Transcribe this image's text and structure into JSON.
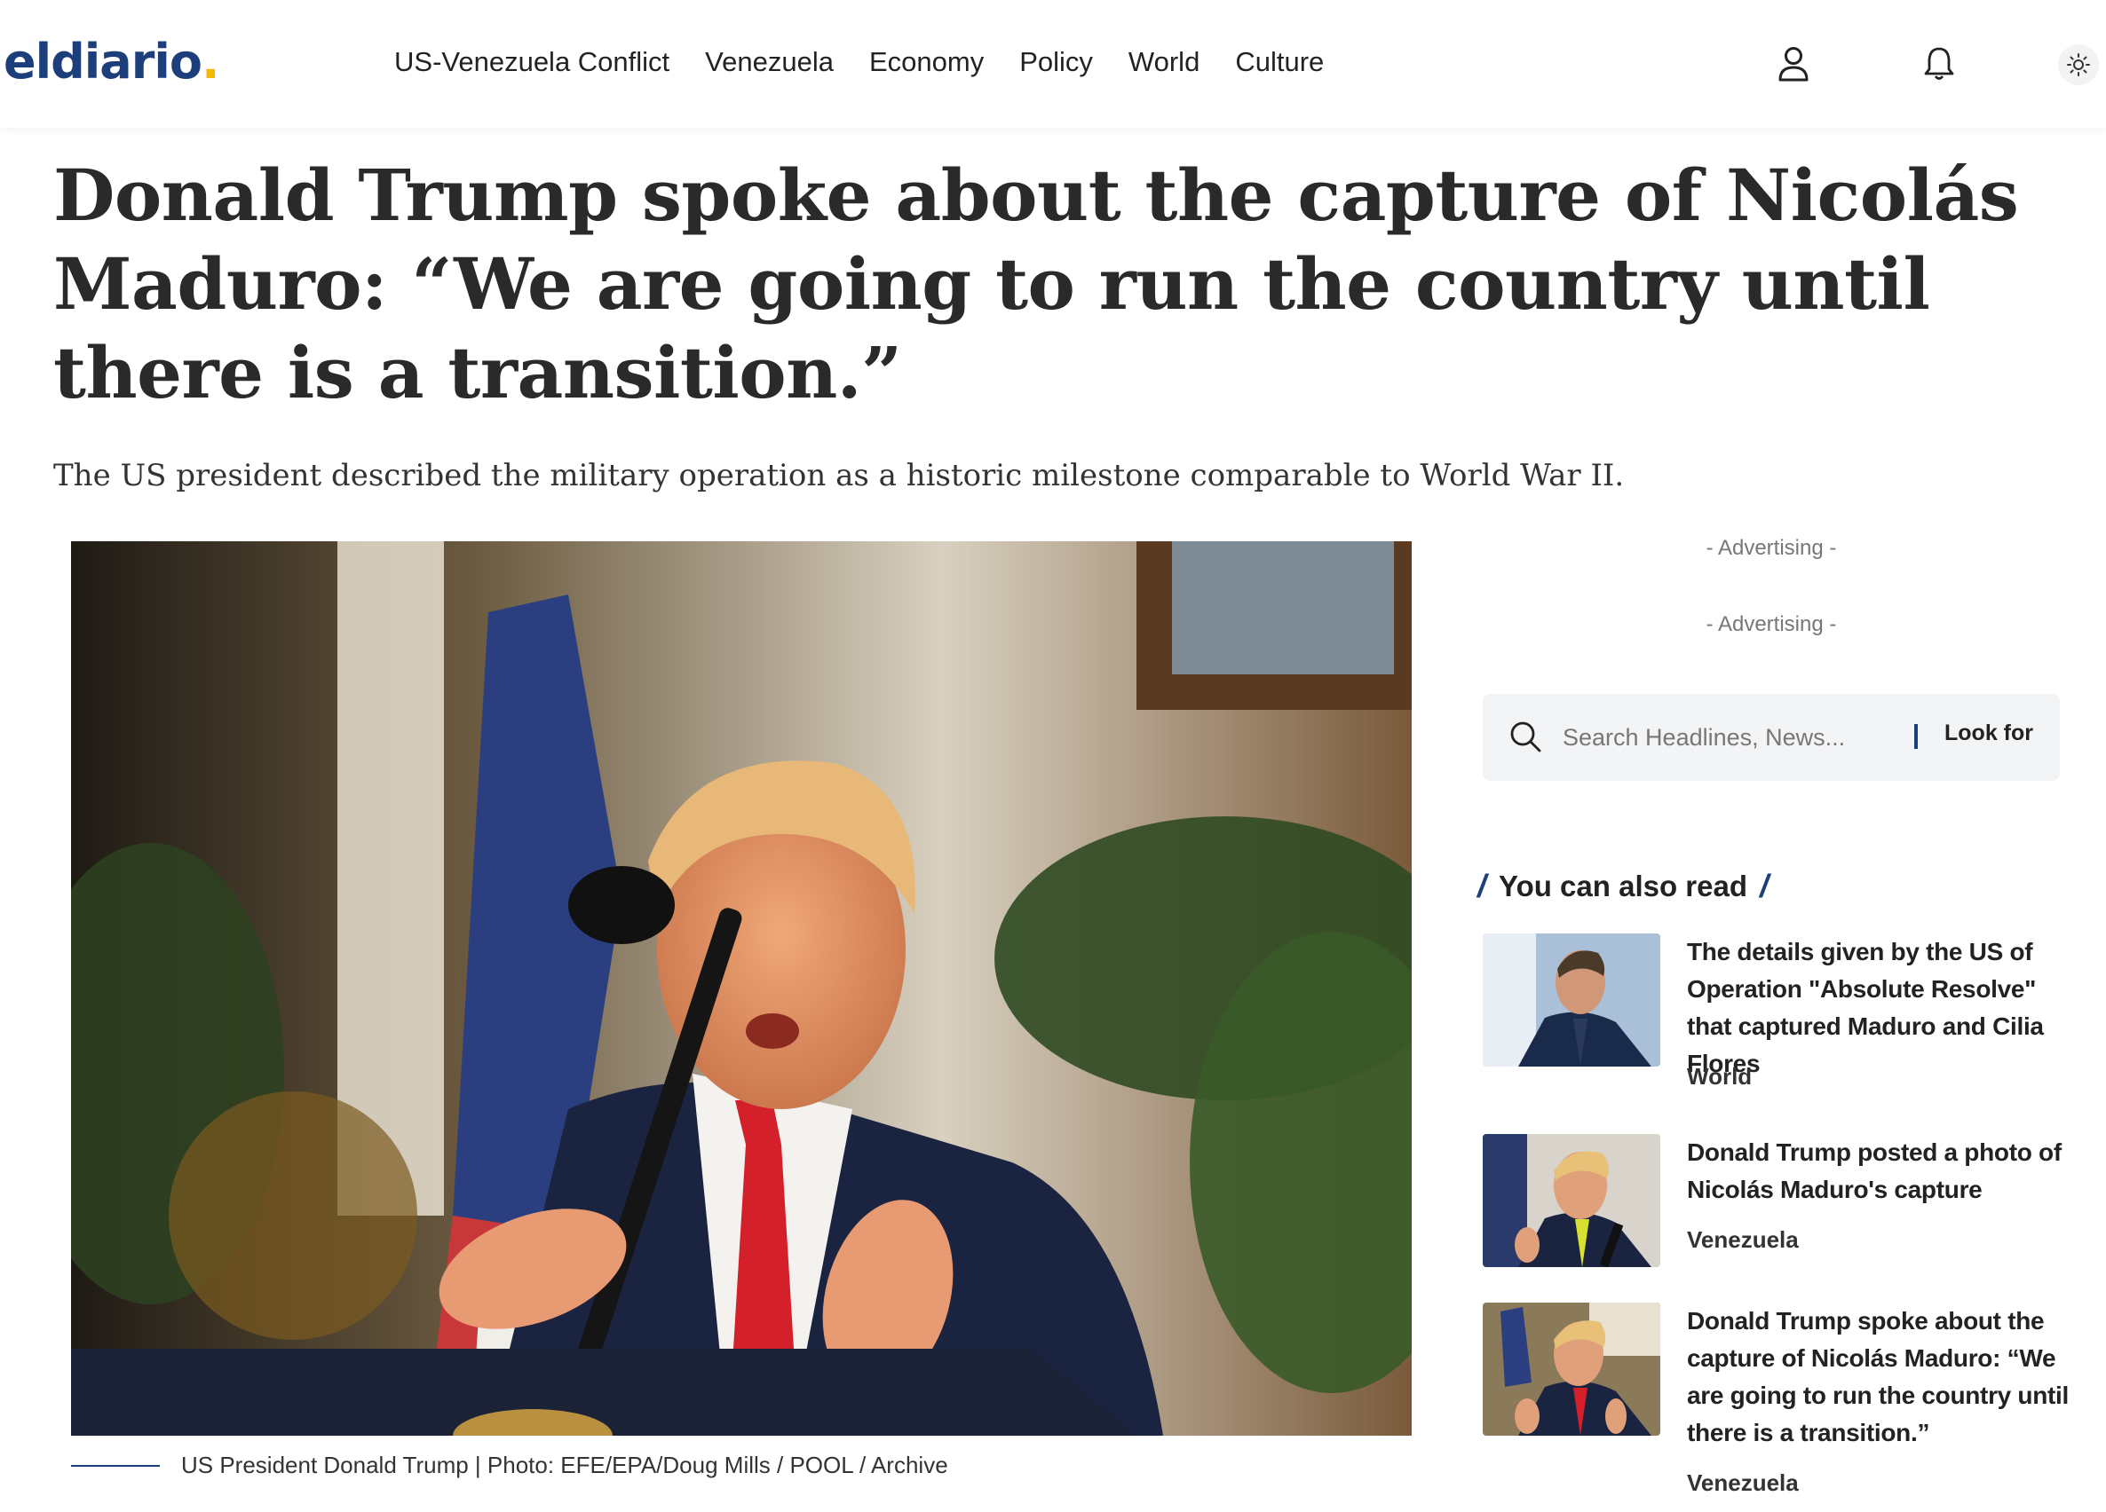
{
  "header": {
    "logo_text": "eldiario",
    "logo_dot": ".",
    "nav": [
      "US-Venezuela Conflict",
      "Venezuela",
      "Economy",
      "Policy",
      "World",
      "Culture"
    ],
    "icons": [
      "user-icon",
      "bell-icon",
      "sun-icon"
    ]
  },
  "article": {
    "headline": "Donald Trump spoke about the capture of Nicolás Maduro: “We are going to run the country until there is a transition.”",
    "subtitle": "The US president described the military operation as a historic milestone comparable to World War II.",
    "caption": "US President Donald Trump | Photo: EFE/EPA/Doug Mills / POOL / Archive"
  },
  "sidebar": {
    "ad_label_1": "- Advertising -",
    "ad_label_2": "- Advertising -",
    "search_placeholder": "Search Headlines, News...",
    "search_button": "Look for",
    "section_title": "You can also read",
    "related": [
      {
        "title": "The details given by the US of Operation \"Absolute Resolve\" that captured Maduro and Cilia Flores",
        "category": "World"
      },
      {
        "title": "Donald Trump posted a photo of Nicolás Maduro's capture",
        "category": "Venezuela"
      },
      {
        "title": "Donald Trump spoke about the capture of Nicolás Maduro: “We are going to run the country until there is a transition.”",
        "category": "Venezuela"
      }
    ]
  },
  "colors": {
    "brand_blue": "#1c3f7c",
    "brand_yellow": "#f5b800",
    "tie_red": "#d4202a"
  }
}
